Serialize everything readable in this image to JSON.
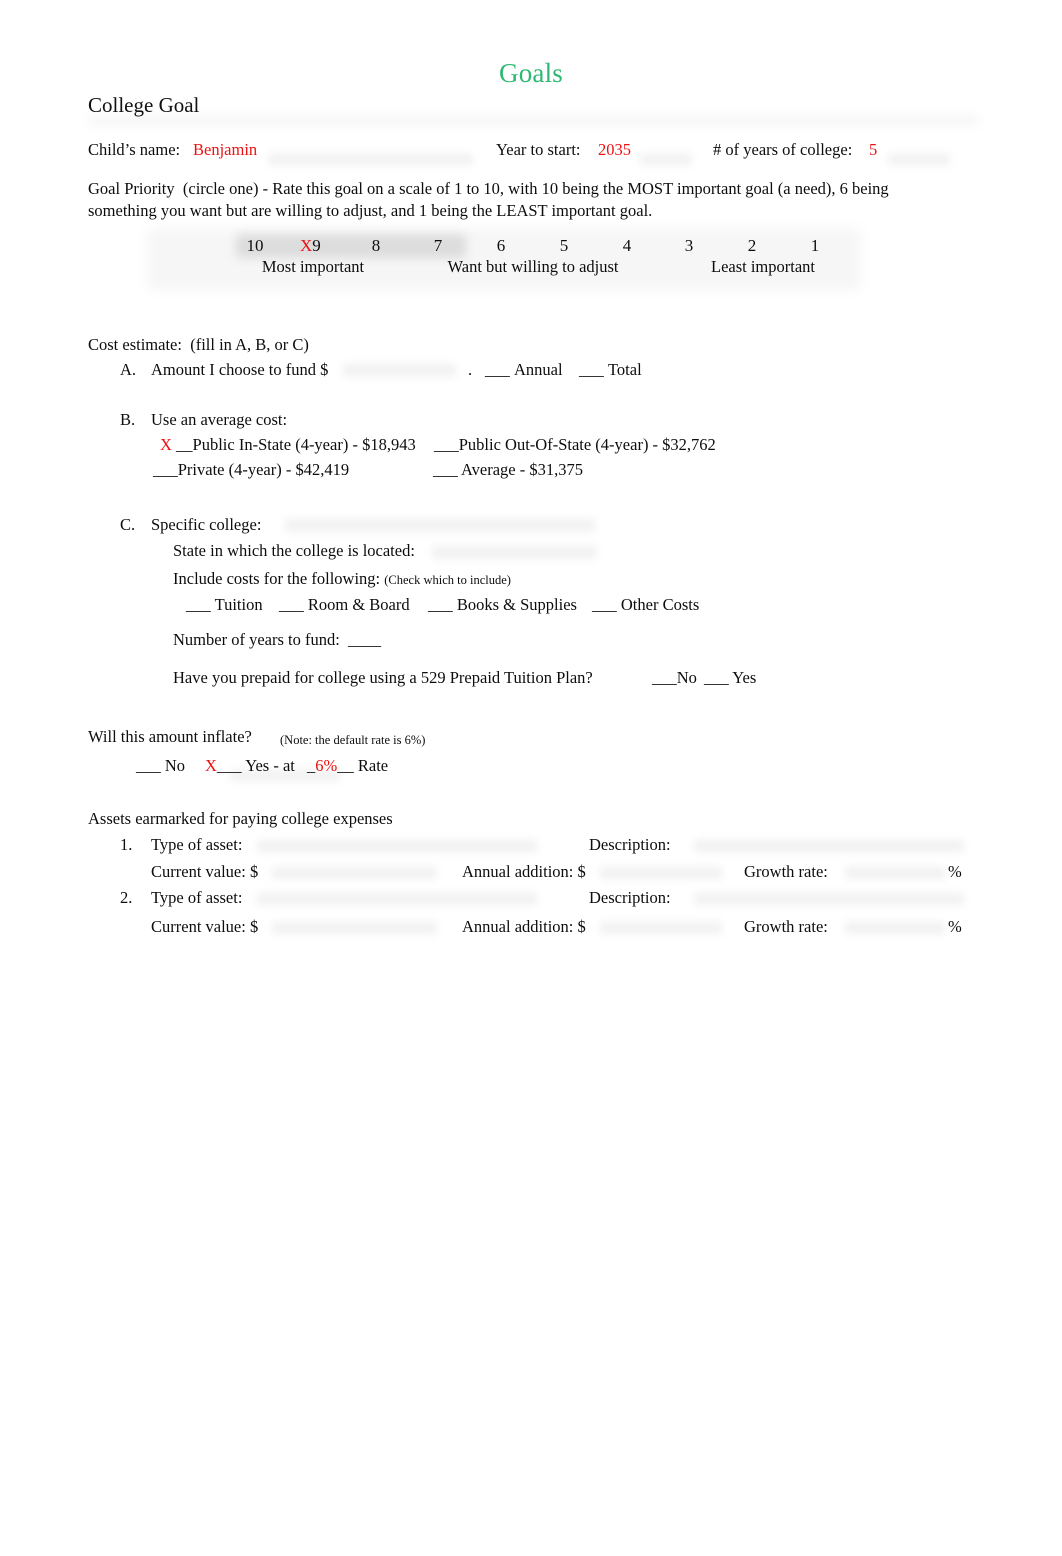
{
  "document": {
    "title": "Goals",
    "title_color": "#2eb873",
    "section_heading": "College Goal",
    "value_color": "#ee1111"
  },
  "identity_row": {
    "child_name_label": "Child’s name:",
    "child_name_value": "Benjamin",
    "year_to_start_label": "Year to start:",
    "year_to_start_value": "2035",
    "years_of_college_label": "# of years of college:",
    "years_of_college_value": "5"
  },
  "goal_priority": {
    "heading": "Goal Priority",
    "instruction": "(circle one) - Rate this goal on a scale of 1 to 10, with 10 being the MOST important goal (a need), 6 being something you want but are willing to adjust, and 1 being the LEAST important goal.",
    "selected_mark": "X",
    "selected_value": "9",
    "numbers": [
      "10",
      "9",
      "8",
      "7",
      "6",
      "5",
      "4",
      "3",
      "2",
      "1"
    ],
    "group_labels": [
      "Most important",
      "Want but willing to adjust",
      "Least important"
    ]
  },
  "cost_estimate": {
    "heading": "Cost estimate:",
    "heading_note": "(fill in A, B, or C)",
    "a": {
      "marker": "A.",
      "text": "Amount I choose to fund $",
      "period": ".",
      "annual_blank": "___",
      "annual_label": "Annual",
      "total_blank": "___",
      "total_label": "Total"
    },
    "b": {
      "marker": "B.",
      "text": "Use an average cost:",
      "options": [
        {
          "mark": "X",
          "blank": "__",
          "label": "Public In-State (4-year) - $18,943"
        },
        {
          "mark": "",
          "blank": "___",
          "label": "Public Out-Of-State (4-year) - $32,762"
        },
        {
          "mark": "",
          "blank": "___",
          "label": "Private (4-year) - $42,419"
        },
        {
          "mark": "",
          "blank": "___",
          "label": "Average  - $31,375"
        }
      ]
    },
    "c": {
      "marker": "C.",
      "text": "Specific college:",
      "state_label": "State in which the college is located:",
      "include_label": "Include costs for the following:",
      "include_note": "(Check which to include)",
      "include_items": [
        "Tuition",
        "Room & Board",
        "Books & Supplies",
        "Other Costs"
      ],
      "include_blank": "___",
      "years_label": "Number of years to fund:",
      "years_blank": "____",
      "prepaid_question": "Have you prepaid for college using a 529 Prepaid Tuition Plan?",
      "prepaid_no_blank": "___",
      "prepaid_no_label": "No",
      "prepaid_yes_blank": "___",
      "prepaid_yes_label": "Yes"
    }
  },
  "inflation": {
    "question": "Will this amount inflate?",
    "note": "(Note: the default rate is 6%)",
    "no_blank": "___",
    "no_label": "No",
    "yes_mark": "X",
    "yes_blank": "___",
    "yes_label": "Yes - at",
    "rate_lead": "_",
    "rate_value": "6%",
    "rate_trail": "__",
    "rate_label": "Rate"
  },
  "assets": {
    "heading": "Assets earmarked for paying college expenses",
    "rows": [
      {
        "number": "1.",
        "type_label": "Type of asset:",
        "description_label": "Description:",
        "current_value_label": "Current value: $",
        "annual_addition_label": "Annual addition: $",
        "growth_rate_label": "Growth rate:",
        "percent_sign": "%"
      },
      {
        "number": "2.",
        "type_label": "Type of asset:",
        "description_label": "Description:",
        "current_value_label": "Current value: $",
        "annual_addition_label": "Annual addition: $",
        "growth_rate_label": "Growth rate:",
        "percent_sign": "%"
      }
    ]
  }
}
